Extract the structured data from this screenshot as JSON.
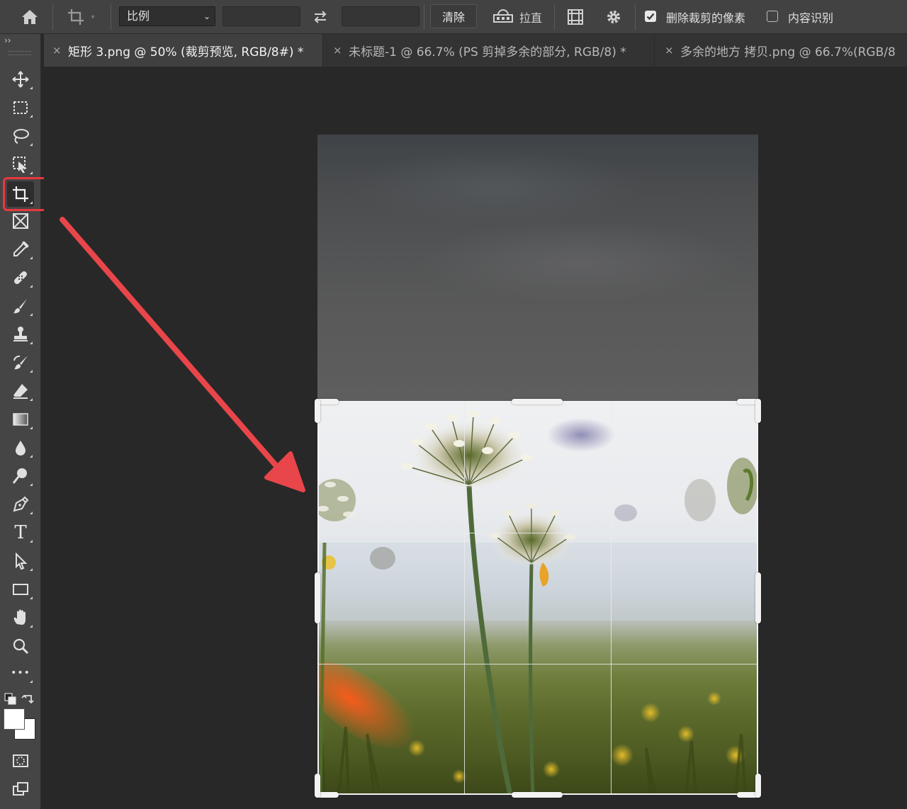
{
  "options_bar": {
    "ratio_select": {
      "value": "比例"
    },
    "clear_button": "清除",
    "straighten_label": "拉直",
    "delete_cropped_pixels": {
      "label": "删除裁剪的像素",
      "checked": true
    },
    "content_aware": {
      "label": "内容识别",
      "checked": false
    }
  },
  "tabs": [
    {
      "title": "矩形 3.png @ 50% (裁剪预览, RGB/8#) *",
      "active": true
    },
    {
      "title": "未标题-1 @ 66.7% (PS 剪掉多余的部分, RGB/8) *",
      "active": false
    },
    {
      "title": "多余的地方 拷贝.png @ 66.7%(RGB/8",
      "active": false
    }
  ],
  "toolbar": {
    "collapse_label": "››",
    "active_tool": "crop-tool",
    "tools": [
      "move-tool",
      "rectangular-marquee-tool",
      "lasso-tool",
      "object-selection-tool",
      "crop-tool",
      "frame-tool",
      "eyedropper-tool",
      "healing-brush-tool",
      "brush-tool",
      "clone-stamp-tool",
      "history-brush-tool",
      "eraser-tool",
      "gradient-tool",
      "blur-tool",
      "dodge-tool",
      "pen-tool",
      "type-tool",
      "path-selection-tool",
      "rectangle-tool",
      "hand-tool",
      "zoom-tool",
      "more-tools"
    ],
    "type_tool_glyph": "T",
    "more_tools_glyph": "•••"
  },
  "colors": {
    "highlight": "#e8383d",
    "arrow": "#e8464a",
    "foreground_swatch": "#ffffff",
    "background_swatch": "#ffffff"
  },
  "crop_overlay": {
    "grid": "rule-of-thirds"
  }
}
